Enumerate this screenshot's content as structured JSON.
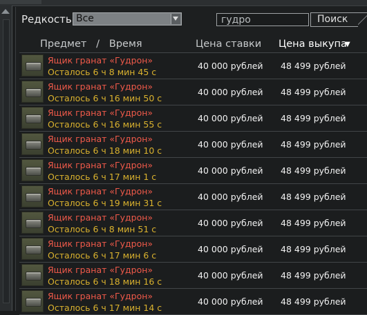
{
  "filter": {
    "rarity_label": "Редкость",
    "rarity_value": "Все",
    "search_value": "гудро",
    "search_button": "Поиск"
  },
  "header": {
    "item_time": "Предмет   /   Время",
    "bid_price": "Цена ставки",
    "buyout_price": "Цена выкупа",
    "sort_indicator": "▼"
  },
  "lots": [
    {
      "name": "Ящик гранат «Гудрон»",
      "time_left": "Осталось 6 ч 8 мин 45 с",
      "bid": "40 000 рублей",
      "buyout": "48 499 рублей"
    },
    {
      "name": "Ящик гранат «Гудрон»",
      "time_left": "Осталось 6 ч 16 мин 50 с",
      "bid": "40 000 рублей",
      "buyout": "48 499 рублей"
    },
    {
      "name": "Ящик гранат «Гудрон»",
      "time_left": "Осталось 6 ч 16 мин 55 с",
      "bid": "40 000 рублей",
      "buyout": "48 499 рублей"
    },
    {
      "name": "Ящик гранат «Гудрон»",
      "time_left": "Осталось 6 ч 18 мин 10 с",
      "bid": "40 000 рублей",
      "buyout": "48 499 рублей"
    },
    {
      "name": "Ящик гранат «Гудрон»",
      "time_left": "Осталось 6 ч 17 мин 1 с",
      "bid": "40 000 рублей",
      "buyout": "48 499 рублей"
    },
    {
      "name": "Ящик гранат «Гудрон»",
      "time_left": "Осталось 6 ч 19 мин 31 с",
      "bid": "40 000 рублей",
      "buyout": "48 499 рублей"
    },
    {
      "name": "Ящик гранат «Гудрон»",
      "time_left": "Осталось 6 ч 8 мин 51 с",
      "bid": "40 000 рублей",
      "buyout": "48 499 рублей"
    },
    {
      "name": "Ящик гранат «Гудрон»",
      "time_left": "Осталось 6 ч 17 мин 6 с",
      "bid": "40 000 рублей",
      "buyout": "48 499 рублей"
    },
    {
      "name": "Ящик гранат «Гудрон»",
      "time_left": "Осталось 6 ч 18 мин 16 с",
      "bid": "40 000 рублей",
      "buyout": "48 499 рублей"
    },
    {
      "name": "Ящик гранат «Гудрон»",
      "time_left": "Осталось 6 ч 17 мин 14 с",
      "bid": "40 000 рублей",
      "buyout": "48 499 рублей"
    }
  ],
  "colors": {
    "item_name": "#f05a4a",
    "time_left": "#dab22e",
    "background": "#1b1d1e"
  },
  "icons": {
    "lot_thumbnail": "grenade-crate-icon",
    "dropdown": "chevron-down-icon",
    "scroll_up": "scroll-up-icon"
  }
}
